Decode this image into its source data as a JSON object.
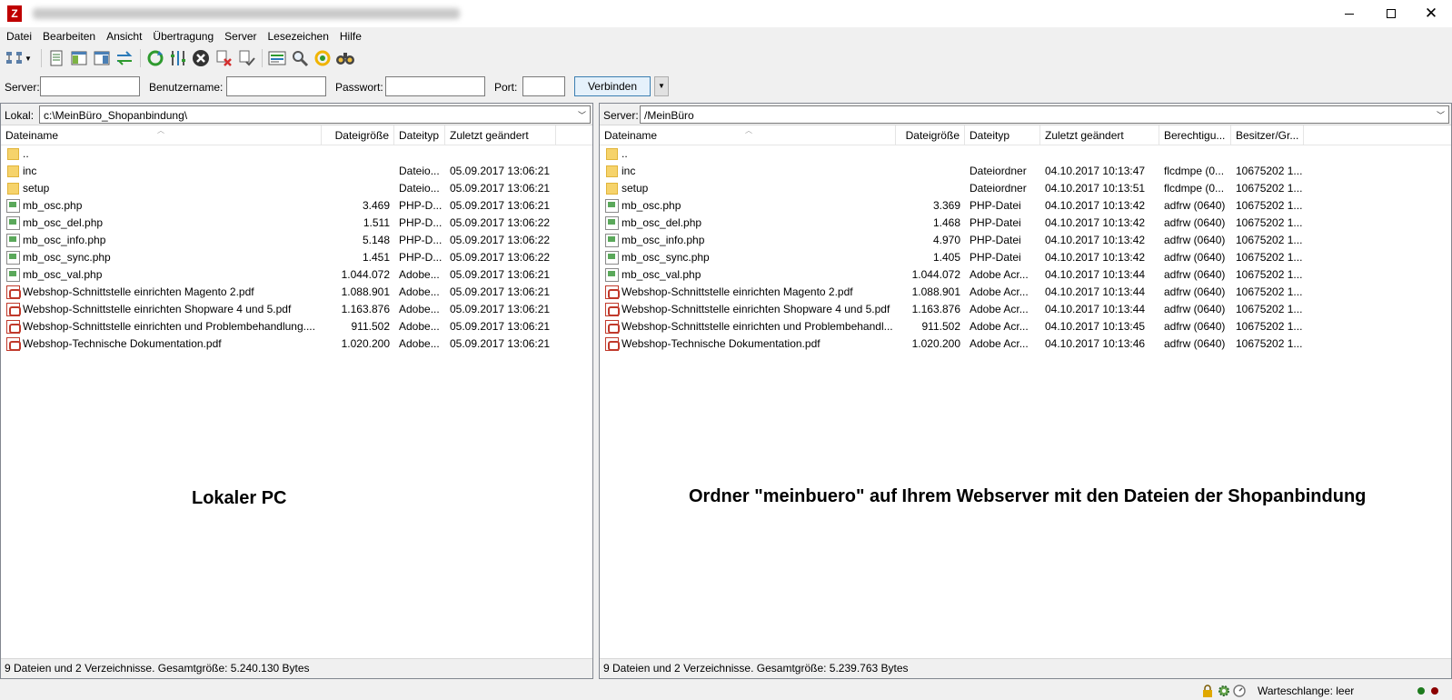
{
  "window": {
    "app_icon": "filezilla-icon",
    "controls": {
      "minimize": "minimize-icon",
      "maximize": "maximize-icon",
      "close": "close-icon",
      "close_glyph": "✕"
    }
  },
  "menu": [
    "Datei",
    "Bearbeiten",
    "Ansicht",
    "Übertragung",
    "Server",
    "Lesezeichen",
    "Hilfe"
  ],
  "toolbar_icons": [
    "site-manager-icon",
    "toggle-message-log-icon",
    "toggle-local-tree-icon",
    "toggle-remote-tree-icon",
    "toggle-queue-icon",
    "refresh-icon",
    "process-queue-icon",
    "cancel-icon",
    "disconnect-icon",
    "reconnect-icon",
    "directory-filter-icon",
    "compare-icon",
    "sync-browse-icon",
    "find-files-icon"
  ],
  "quickconnect": {
    "server_label": "Server:",
    "user_label": "Benutzername:",
    "password_label": "Passwort:",
    "port_label": "Port:",
    "server_value": "",
    "user_value": "",
    "password_value": "",
    "port_value": "",
    "connect_label": "Verbinden"
  },
  "local": {
    "path_label": "Lokal:",
    "path": "c:\\MeinBüro_Shopanbindung\\",
    "columns": [
      "Dateiname",
      "Dateigröße",
      "Dateityp",
      "Zuletzt geändert"
    ],
    "rows": [
      {
        "icon": "folder",
        "name": "..",
        "size": "",
        "type": "",
        "modified": ""
      },
      {
        "icon": "folder",
        "name": "inc",
        "size": "",
        "type": "Dateio...",
        "modified": "05.09.2017 13:06:21"
      },
      {
        "icon": "folder",
        "name": "setup",
        "size": "",
        "type": "Dateio...",
        "modified": "05.09.2017 13:06:21"
      },
      {
        "icon": "php",
        "name": "mb_osc.php",
        "size": "3.469",
        "type": "PHP-D...",
        "modified": "05.09.2017 13:06:21"
      },
      {
        "icon": "php",
        "name": "mb_osc_del.php",
        "size": "1.511",
        "type": "PHP-D...",
        "modified": "05.09.2017 13:06:22"
      },
      {
        "icon": "php",
        "name": "mb_osc_info.php",
        "size": "5.148",
        "type": "PHP-D...",
        "modified": "05.09.2017 13:06:22"
      },
      {
        "icon": "php",
        "name": "mb_osc_sync.php",
        "size": "1.451",
        "type": "PHP-D...",
        "modified": "05.09.2017 13:06:22"
      },
      {
        "icon": "php",
        "name": "mb_osc_val.php",
        "size": "1.044.072",
        "type": "Adobe...",
        "modified": "05.09.2017 13:06:21"
      },
      {
        "icon": "pdf",
        "name": "Webshop-Schnittstelle einrichten Magento 2.pdf",
        "size": "1.088.901",
        "type": "Adobe...",
        "modified": "05.09.2017 13:06:21"
      },
      {
        "icon": "pdf",
        "name": "Webshop-Schnittstelle einrichten Shopware 4 und 5.pdf",
        "size": "1.163.876",
        "type": "Adobe...",
        "modified": "05.09.2017 13:06:21"
      },
      {
        "icon": "pdf",
        "name": "Webshop-Schnittstelle einrichten und Problembehandlung....",
        "size": "911.502",
        "type": "Adobe...",
        "modified": "05.09.2017 13:06:21"
      },
      {
        "icon": "pdf",
        "name": "Webshop-Technische Dokumentation.pdf",
        "size": "1.020.200",
        "type": "Adobe...",
        "modified": "05.09.2017 13:06:21"
      }
    ],
    "status": "9 Dateien und 2 Verzeichnisse. Gesamtgröße: 5.240.130 Bytes"
  },
  "remote": {
    "path_label": "Server:",
    "path": "/MeinBüro",
    "columns": [
      "Dateiname",
      "Dateigröße",
      "Dateityp",
      "Zuletzt geändert",
      "Berechtigu...",
      "Besitzer/Gr..."
    ],
    "rows": [
      {
        "icon": "folder",
        "name": "..",
        "size": "",
        "type": "",
        "modified": "",
        "perm": "",
        "owner": ""
      },
      {
        "icon": "folder",
        "name": "inc",
        "size": "",
        "type": "Dateiordner",
        "modified": "04.10.2017 10:13:47",
        "perm": "flcdmpe (0...",
        "owner": "10675202 1..."
      },
      {
        "icon": "folder",
        "name": "setup",
        "size": "",
        "type": "Dateiordner",
        "modified": "04.10.2017 10:13:51",
        "perm": "flcdmpe (0...",
        "owner": "10675202 1..."
      },
      {
        "icon": "php",
        "name": "mb_osc.php",
        "size": "3.369",
        "type": "PHP-Datei",
        "modified": "04.10.2017 10:13:42",
        "perm": "adfrw (0640)",
        "owner": "10675202 1..."
      },
      {
        "icon": "php",
        "name": "mb_osc_del.php",
        "size": "1.468",
        "type": "PHP-Datei",
        "modified": "04.10.2017 10:13:42",
        "perm": "adfrw (0640)",
        "owner": "10675202 1..."
      },
      {
        "icon": "php",
        "name": "mb_osc_info.php",
        "size": "4.970",
        "type": "PHP-Datei",
        "modified": "04.10.2017 10:13:42",
        "perm": "adfrw (0640)",
        "owner": "10675202 1..."
      },
      {
        "icon": "php",
        "name": "mb_osc_sync.php",
        "size": "1.405",
        "type": "PHP-Datei",
        "modified": "04.10.2017 10:13:42",
        "perm": "adfrw (0640)",
        "owner": "10675202 1..."
      },
      {
        "icon": "php",
        "name": "mb_osc_val.php",
        "size": "1.044.072",
        "type": "Adobe Acr...",
        "modified": "04.10.2017 10:13:44",
        "perm": "adfrw (0640)",
        "owner": "10675202 1..."
      },
      {
        "icon": "pdf",
        "name": "Webshop-Schnittstelle einrichten Magento 2.pdf",
        "size": "1.088.901",
        "type": "Adobe Acr...",
        "modified": "04.10.2017 10:13:44",
        "perm": "adfrw (0640)",
        "owner": "10675202 1..."
      },
      {
        "icon": "pdf",
        "name": "Webshop-Schnittstelle einrichten Shopware 4 und 5.pdf",
        "size": "1.163.876",
        "type": "Adobe Acr...",
        "modified": "04.10.2017 10:13:44",
        "perm": "adfrw (0640)",
        "owner": "10675202 1..."
      },
      {
        "icon": "pdf",
        "name": "Webshop-Schnittstelle einrichten und Problembehandl...",
        "size": "911.502",
        "type": "Adobe Acr...",
        "modified": "04.10.2017 10:13:45",
        "perm": "adfrw (0640)",
        "owner": "10675202 1..."
      },
      {
        "icon": "pdf",
        "name": "Webshop-Technische Dokumentation.pdf",
        "size": "1.020.200",
        "type": "Adobe Acr...",
        "modified": "04.10.2017 10:13:46",
        "perm": "adfrw (0640)",
        "owner": "10675202 1..."
      }
    ],
    "status": "9 Dateien und 2 Verzeichnisse. Gesamtgröße: 5.239.763 Bytes"
  },
  "annotations": {
    "local": "Lokaler PC",
    "remote": "Ordner \"meinbuero\" auf Ihrem Webserver mit den Dateien der Shopanbindung"
  },
  "statusbar": {
    "queue": "Warteschlange: leer",
    "icons": [
      "lock-icon",
      "gear-icon",
      "speed-limit-icon"
    ],
    "led_colors": [
      "#1e7b1e",
      "#8b0000"
    ]
  }
}
